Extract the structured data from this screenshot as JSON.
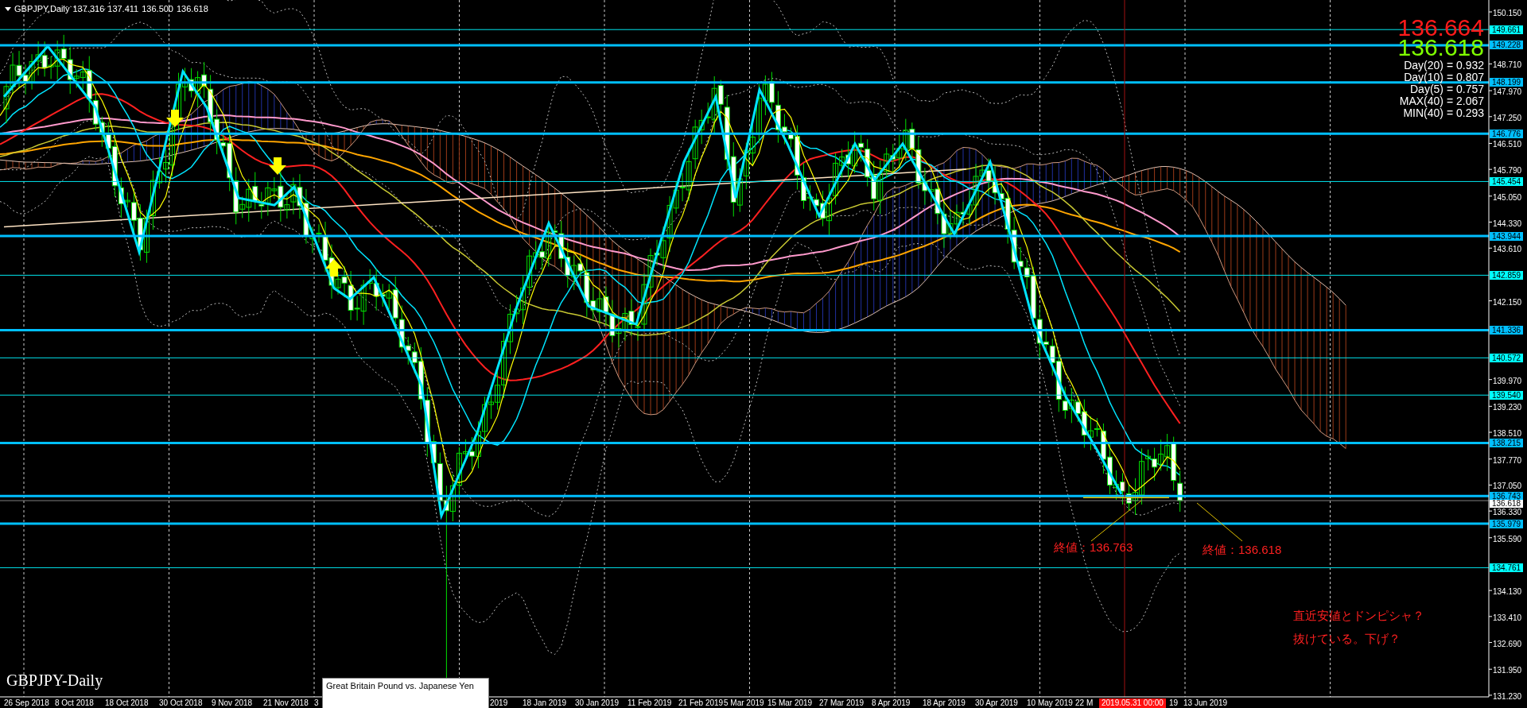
{
  "header": {
    "symbol": "GBPJPY,Daily",
    "ohlc": [
      "137.316",
      "137.411",
      "136.500",
      "136.618"
    ]
  },
  "price_display": {
    "upper_price": "136.664",
    "lower_price": "136.618"
  },
  "stats": [
    "Day(20) = 0.932",
    "Day(10) = 0.807",
    "Day(5) = 0.757",
    "MAX(40) = 2.067",
    "MIN(40) = 0.293"
  ],
  "price_axis": {
    "ticks": [
      "150.150",
      "148.710",
      "147.970",
      "147.250",
      "146.510",
      "145.790",
      "145.050",
      "144.330",
      "143.610",
      "142.150",
      "139.970",
      "139.230",
      "138.510",
      "137.770",
      "137.050",
      "136.330",
      "135.590",
      "134.130",
      "133.410",
      "132.690",
      "131.950",
      "131.230"
    ],
    "levels": [
      {
        "label": "149.661",
        "kind": "thin"
      },
      {
        "label": "149.228",
        "kind": "thick"
      },
      {
        "label": "148.199",
        "kind": "thick"
      },
      {
        "label": "146.776",
        "kind": "thick"
      },
      {
        "label": "145.454",
        "kind": "thin"
      },
      {
        "label": "143.944",
        "kind": "thick"
      },
      {
        "label": "142.859",
        "kind": "thin"
      },
      {
        "label": "141.336",
        "kind": "thick"
      },
      {
        "label": "140.572",
        "kind": "thin"
      },
      {
        "label": "139.540",
        "kind": "thin"
      },
      {
        "label": "138.215",
        "kind": "thick"
      },
      {
        "label": "136.743",
        "kind": "thick"
      },
      {
        "label": "136.618",
        "kind": "current"
      },
      {
        "label": "135.979",
        "kind": "thick"
      },
      {
        "label": "134.761",
        "kind": "thin"
      }
    ]
  },
  "time_axis": {
    "labels": [
      "26 Sep 2018",
      "8 Oct 2018",
      "18 Oct 2018",
      "30 Oct 2018",
      "9 Nov 2018",
      "21 Nov 2018",
      "3",
      "2019",
      "18 Jan 2019",
      "30 Jan 2019",
      "11 Feb 2019",
      "21 Feb 2019",
      "5 Mar 2019",
      "15 Mar 2019",
      "27 Mar 2019",
      "8 Apr 2019",
      "18 Apr 2019",
      "30 Apr 2019",
      "10 May 2019",
      "22 M",
      "19",
      "13 Jun 2019"
    ],
    "cursor_time": "2019.05.31 00:00"
  },
  "annotations": [
    "終値：136.763",
    "終値：136.618",
    "直近安値とドンピシャ？",
    "抜けている。下げ？"
  ],
  "tooltip": "Great Britain Pound vs. Japanese Yen",
  "chart_label": "GBPJPY-Daily"
}
